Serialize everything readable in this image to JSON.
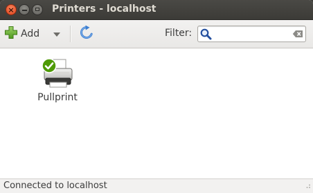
{
  "window": {
    "title": "Printers - localhost"
  },
  "toolbar": {
    "add_label": "Add",
    "add_icon": "plus-icon",
    "dropdown_icon": "chevron-down-icon",
    "refresh_icon": "refresh-icon",
    "filter_label": "Filter:",
    "filter_value": "",
    "filter_placeholder": "",
    "search_icon": "search-icon",
    "clear_icon": "clear-icon"
  },
  "printers": [
    {
      "name": "Pullprint",
      "icon": "printer-icon",
      "default_badge": "default-check-icon"
    }
  ],
  "status": {
    "text": "Connected to localhost"
  },
  "colors": {
    "titlebar": "#3c3b37",
    "title_text": "#dfdbd2",
    "close_button": "#e0421a",
    "add_green": "#6bb33b",
    "refresh_blue": "#3d7fd1",
    "search_blue": "#244f9e",
    "default_check": "#4e9a06"
  }
}
